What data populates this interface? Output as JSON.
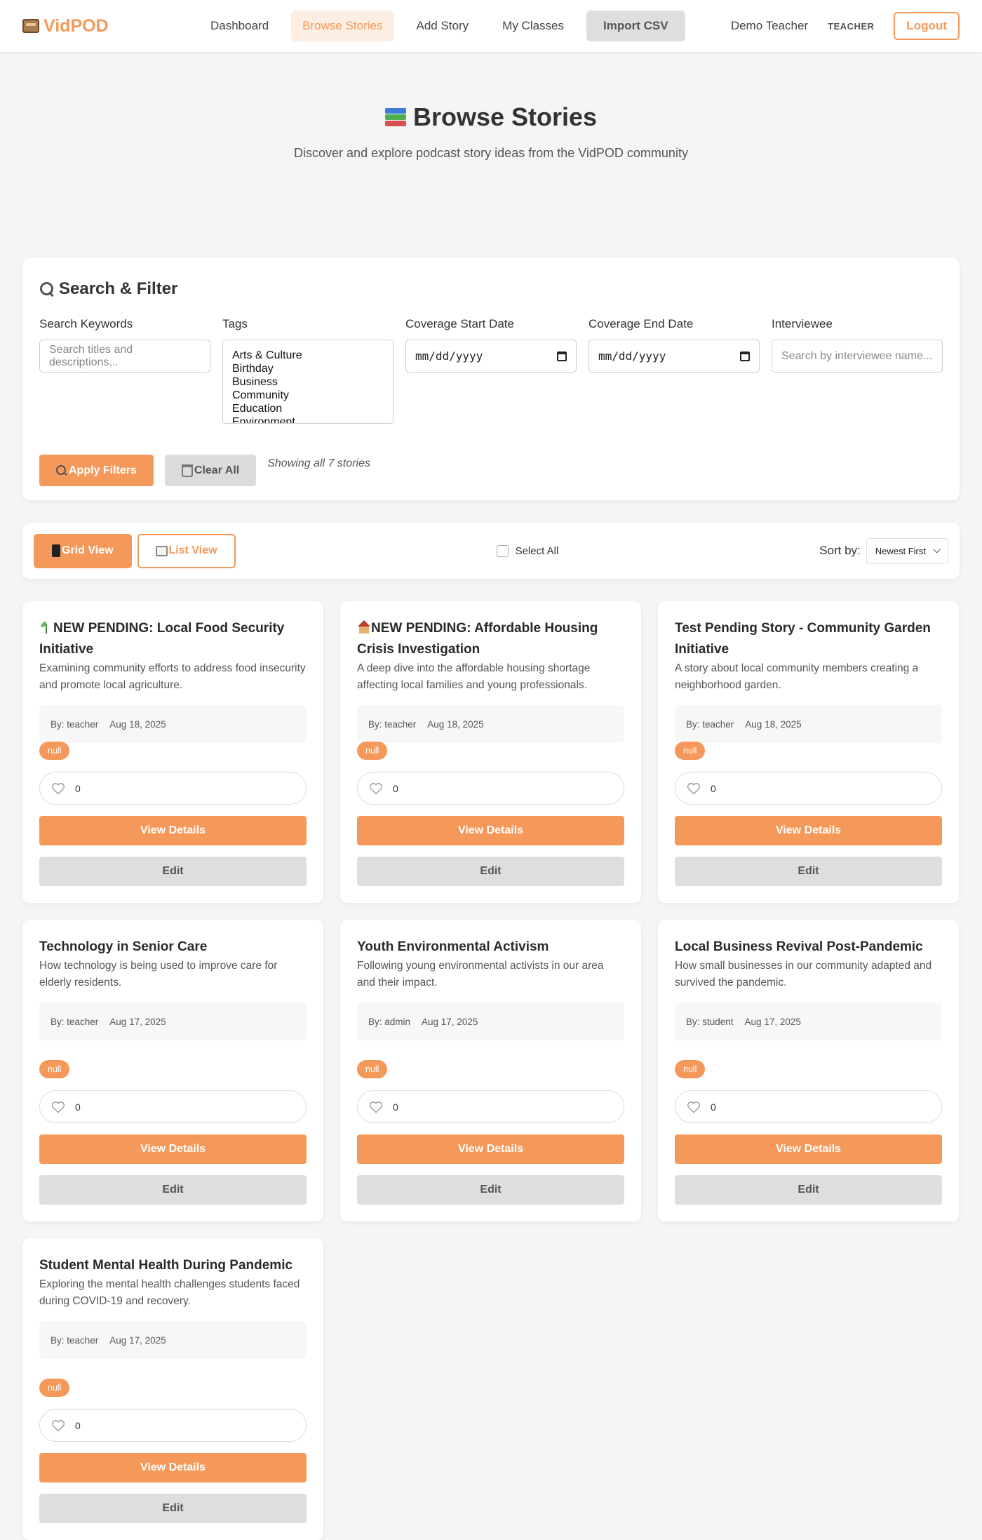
{
  "header": {
    "logo_text": "VidPOD",
    "nav": [
      {
        "label": "Dashboard",
        "active": false
      },
      {
        "label": "Browse Stories",
        "active": true
      },
      {
        "label": "Add Story",
        "active": false
      },
      {
        "label": "My Classes",
        "active": false
      }
    ],
    "import_csv": "Import CSV",
    "user_name": "Demo Teacher",
    "user_role": "TEACHER",
    "logout": "Logout"
  },
  "page": {
    "title": "Browse Stories",
    "subtitle": "Discover and explore podcast story ideas from the VidPOD community"
  },
  "filters": {
    "title": "Search & Filter",
    "keywords_label": "Search Keywords",
    "keywords_placeholder": "Search titles and descriptions...",
    "tags_label": "Tags",
    "tags": [
      "Arts & Culture",
      "Birthday",
      "Business",
      "Community",
      "Education",
      "Environment"
    ],
    "start_label": "Coverage Start Date",
    "start_value": "mm/dd/yyyy",
    "end_label": "Coverage End Date",
    "end_value": "mm/dd/yyyy",
    "interviewee_label": "Interviewee",
    "interviewee_placeholder": "Search by interviewee name...",
    "apply": "Apply Filters",
    "clear": "Clear All",
    "status": "Showing all 7 stories"
  },
  "toolbar": {
    "grid_view": "Grid View",
    "list_view": "List View",
    "select_all": "Select All",
    "sort_label": "Sort by:",
    "sort_value": "Newest First"
  },
  "stories": [
    {
      "icon": "sprout-icon",
      "title": "NEW PENDING: Local Food Security Initiative",
      "description": "Examining community efforts to address food insecurity and promote local agriculture.",
      "author": "By: teacher",
      "date": "Aug 18, 2025",
      "tag": "null",
      "likes": "0",
      "view": "View Details",
      "edit": "Edit"
    },
    {
      "icon": "house-icon",
      "title": "NEW PENDING: Affordable Housing Crisis Investigation",
      "description": "A deep dive into the affordable housing shortage affecting local families and young professionals.",
      "author": "By: teacher",
      "date": "Aug 18, 2025",
      "tag": "null",
      "likes": "0",
      "view": "View Details",
      "edit": "Edit"
    },
    {
      "icon": "",
      "title": "Test Pending Story - Community Garden Initiative",
      "description": "A story about local community members creating a neighborhood garden.",
      "author": "By: teacher",
      "date": "Aug 18, 2025",
      "tag": "null",
      "likes": "0",
      "view": "View Details",
      "edit": "Edit"
    },
    {
      "icon": "",
      "title": "Technology in Senior Care",
      "description": "How technology is being used to improve care for elderly residents.",
      "author": "By: teacher",
      "date": "Aug 17, 2025",
      "tag": "null",
      "likes": "0",
      "view": "View Details",
      "edit": "Edit"
    },
    {
      "icon": "",
      "title": "Youth Environmental Activism",
      "description": "Following young environmental activists in our area and their impact.",
      "author": "By: admin",
      "date": "Aug 17, 2025",
      "tag": "null",
      "likes": "0",
      "view": "View Details",
      "edit": "Edit"
    },
    {
      "icon": "",
      "title": "Local Business Revival Post-Pandemic",
      "description": "How small businesses in our community adapted and survived the pandemic.",
      "author": "By: student",
      "date": "Aug 17, 2025",
      "tag": "null",
      "likes": "0",
      "view": "View Details",
      "edit": "Edit"
    },
    {
      "icon": "",
      "title": "Student Mental Health During Pandemic",
      "description": "Exploring the mental health challenges students faced during COVID-19 and recovery.",
      "author": "By: teacher",
      "date": "Aug 17, 2025",
      "tag": "null",
      "likes": "0",
      "view": "View Details",
      "edit": "Edit"
    }
  ]
}
